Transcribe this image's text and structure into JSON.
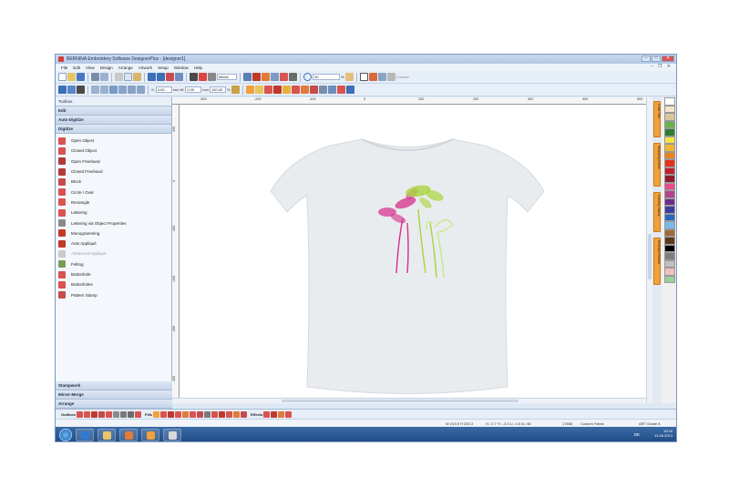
{
  "window": {
    "title": "BERNINA Embroidery Software DesignerPlus - [designer1]",
    "controls": [
      "–",
      "□",
      "✕"
    ],
    "mdi_controls": "– ❐ ✕"
  },
  "menu": [
    "File",
    "Edit",
    "View",
    "Design",
    "Arrange",
    "Artwork",
    "Setup",
    "Window",
    "Help"
  ],
  "toolbar": {
    "units": "Metric",
    "zoom": "40",
    "zoom_unit": "%",
    "convert_label": "Convert",
    "x_label": "X:",
    "x_value": "0.00",
    "y_label": "Y:",
    "y_value": "0.00",
    "w_label": "W:",
    "w_value": "0.00",
    "h_label": "H:",
    "h_value": "0.00",
    "unit_mm": "mm",
    "scale_w": "100.00",
    "scale_h": "100.00",
    "scale_unit": "%"
  },
  "sidebar": {
    "toolbox": "Toolbox",
    "edit": "Edit",
    "auto_digitize": "Auto-Digitize",
    "digitize": "Digitize",
    "items": [
      {
        "label": "Open Object",
        "icon": "open-object-icon",
        "color": "#d9534f",
        "enabled": true
      },
      {
        "label": "Closed Object",
        "icon": "closed-object-icon",
        "color": "#d9534f",
        "enabled": true
      },
      {
        "label": "Open Freehand",
        "icon": "open-freehand-icon",
        "color": "#b03a3a",
        "enabled": true
      },
      {
        "label": "Closed Freehand",
        "icon": "closed-freehand-icon",
        "color": "#b03a3a",
        "enabled": true
      },
      {
        "label": "Block",
        "icon": "block-icon",
        "color": "#c74a4a",
        "enabled": true
      },
      {
        "label": "Circle / Oval",
        "icon": "circle-oval-icon",
        "color": "#d9534f",
        "enabled": true
      },
      {
        "label": "Rectangle",
        "icon": "rectangle-icon",
        "color": "#d9534f",
        "enabled": true
      },
      {
        "label": "Lettering",
        "icon": "lettering-icon",
        "color": "#d9534f",
        "enabled": true
      },
      {
        "label": "Lettering via Object Properties",
        "icon": "lettering-properties-icon",
        "color": "#8a8a8a",
        "enabled": true
      },
      {
        "label": "Monogramming",
        "icon": "monogramming-icon",
        "color": "#c0392b",
        "enabled": true
      },
      {
        "label": "Auto Appliqué",
        "icon": "auto-applique-icon",
        "color": "#c0392b",
        "enabled": true
      },
      {
        "label": "Advanced Appliqué",
        "icon": "advanced-applique-icon",
        "color": "#c9c9c9",
        "enabled": false
      },
      {
        "label": "Felting",
        "icon": "felting-icon",
        "color": "#7a9a5a",
        "enabled": true
      },
      {
        "label": "Buttonhole",
        "icon": "buttonhole-icon",
        "color": "#d9534f",
        "enabled": true
      },
      {
        "label": "Buttonholes",
        "icon": "buttonholes-icon",
        "color": "#d9534f",
        "enabled": true
      },
      {
        "label": "Pattern Stamp",
        "icon": "pattern-stamp-icon",
        "color": "#c74a4a",
        "enabled": true
      }
    ],
    "stampwork": "Stampwork",
    "mirror_merge": "Mirror-Merge",
    "arrange": "Arrange"
  },
  "ruler": {
    "top_ticks": [
      "-300",
      "-200",
      "-100",
      "0",
      "100",
      "200",
      "300",
      "400",
      "500"
    ],
    "left_ticks": [
      "100",
      "0",
      "-100",
      "-200",
      "-300",
      "-400"
    ]
  },
  "side_tabs": [
    "Color Film",
    "Wrapping Effect",
    "Carving Stamp",
    "Reshape Border"
  ],
  "palette_colors": [
    "#ffffff",
    "#f3e6c8",
    "#d9c69a",
    "#69b34c",
    "#2e7d32",
    "#f5e642",
    "#f2b632",
    "#e8841c",
    "#e2341d",
    "#c21f2c",
    "#8e1b2e",
    "#e84a8a",
    "#b3438c",
    "#6b2c8a",
    "#3d3d9c",
    "#2767c0",
    "#7ab8e8",
    "#9e6b3b",
    "#5a3a1e",
    "#000000",
    "#7f7f7f",
    "#bfbfbf",
    "#f0c0c0",
    "#9bcf9b"
  ],
  "bottom_toolbar": {
    "outlines_label": "Outlines",
    "fills_label": "Fills",
    "effects_label": "Effects"
  },
  "status": {
    "dimensions": "W 219.5 H 200.3",
    "coords": "X= 2.7  Y= -3.0  L= 4.0  A= 48",
    "stitches": "17808",
    "fabric": "Custom Fabric",
    "grade": "ART Grade A"
  },
  "taskbar": {
    "lang": "DE",
    "time": "10:18",
    "date": "11.06.2013"
  },
  "colors": {
    "accent": "#f2a03a",
    "flower_pink": "#d62e8a",
    "flower_green": "#a8d43c",
    "shirt": "#e9ecef"
  }
}
